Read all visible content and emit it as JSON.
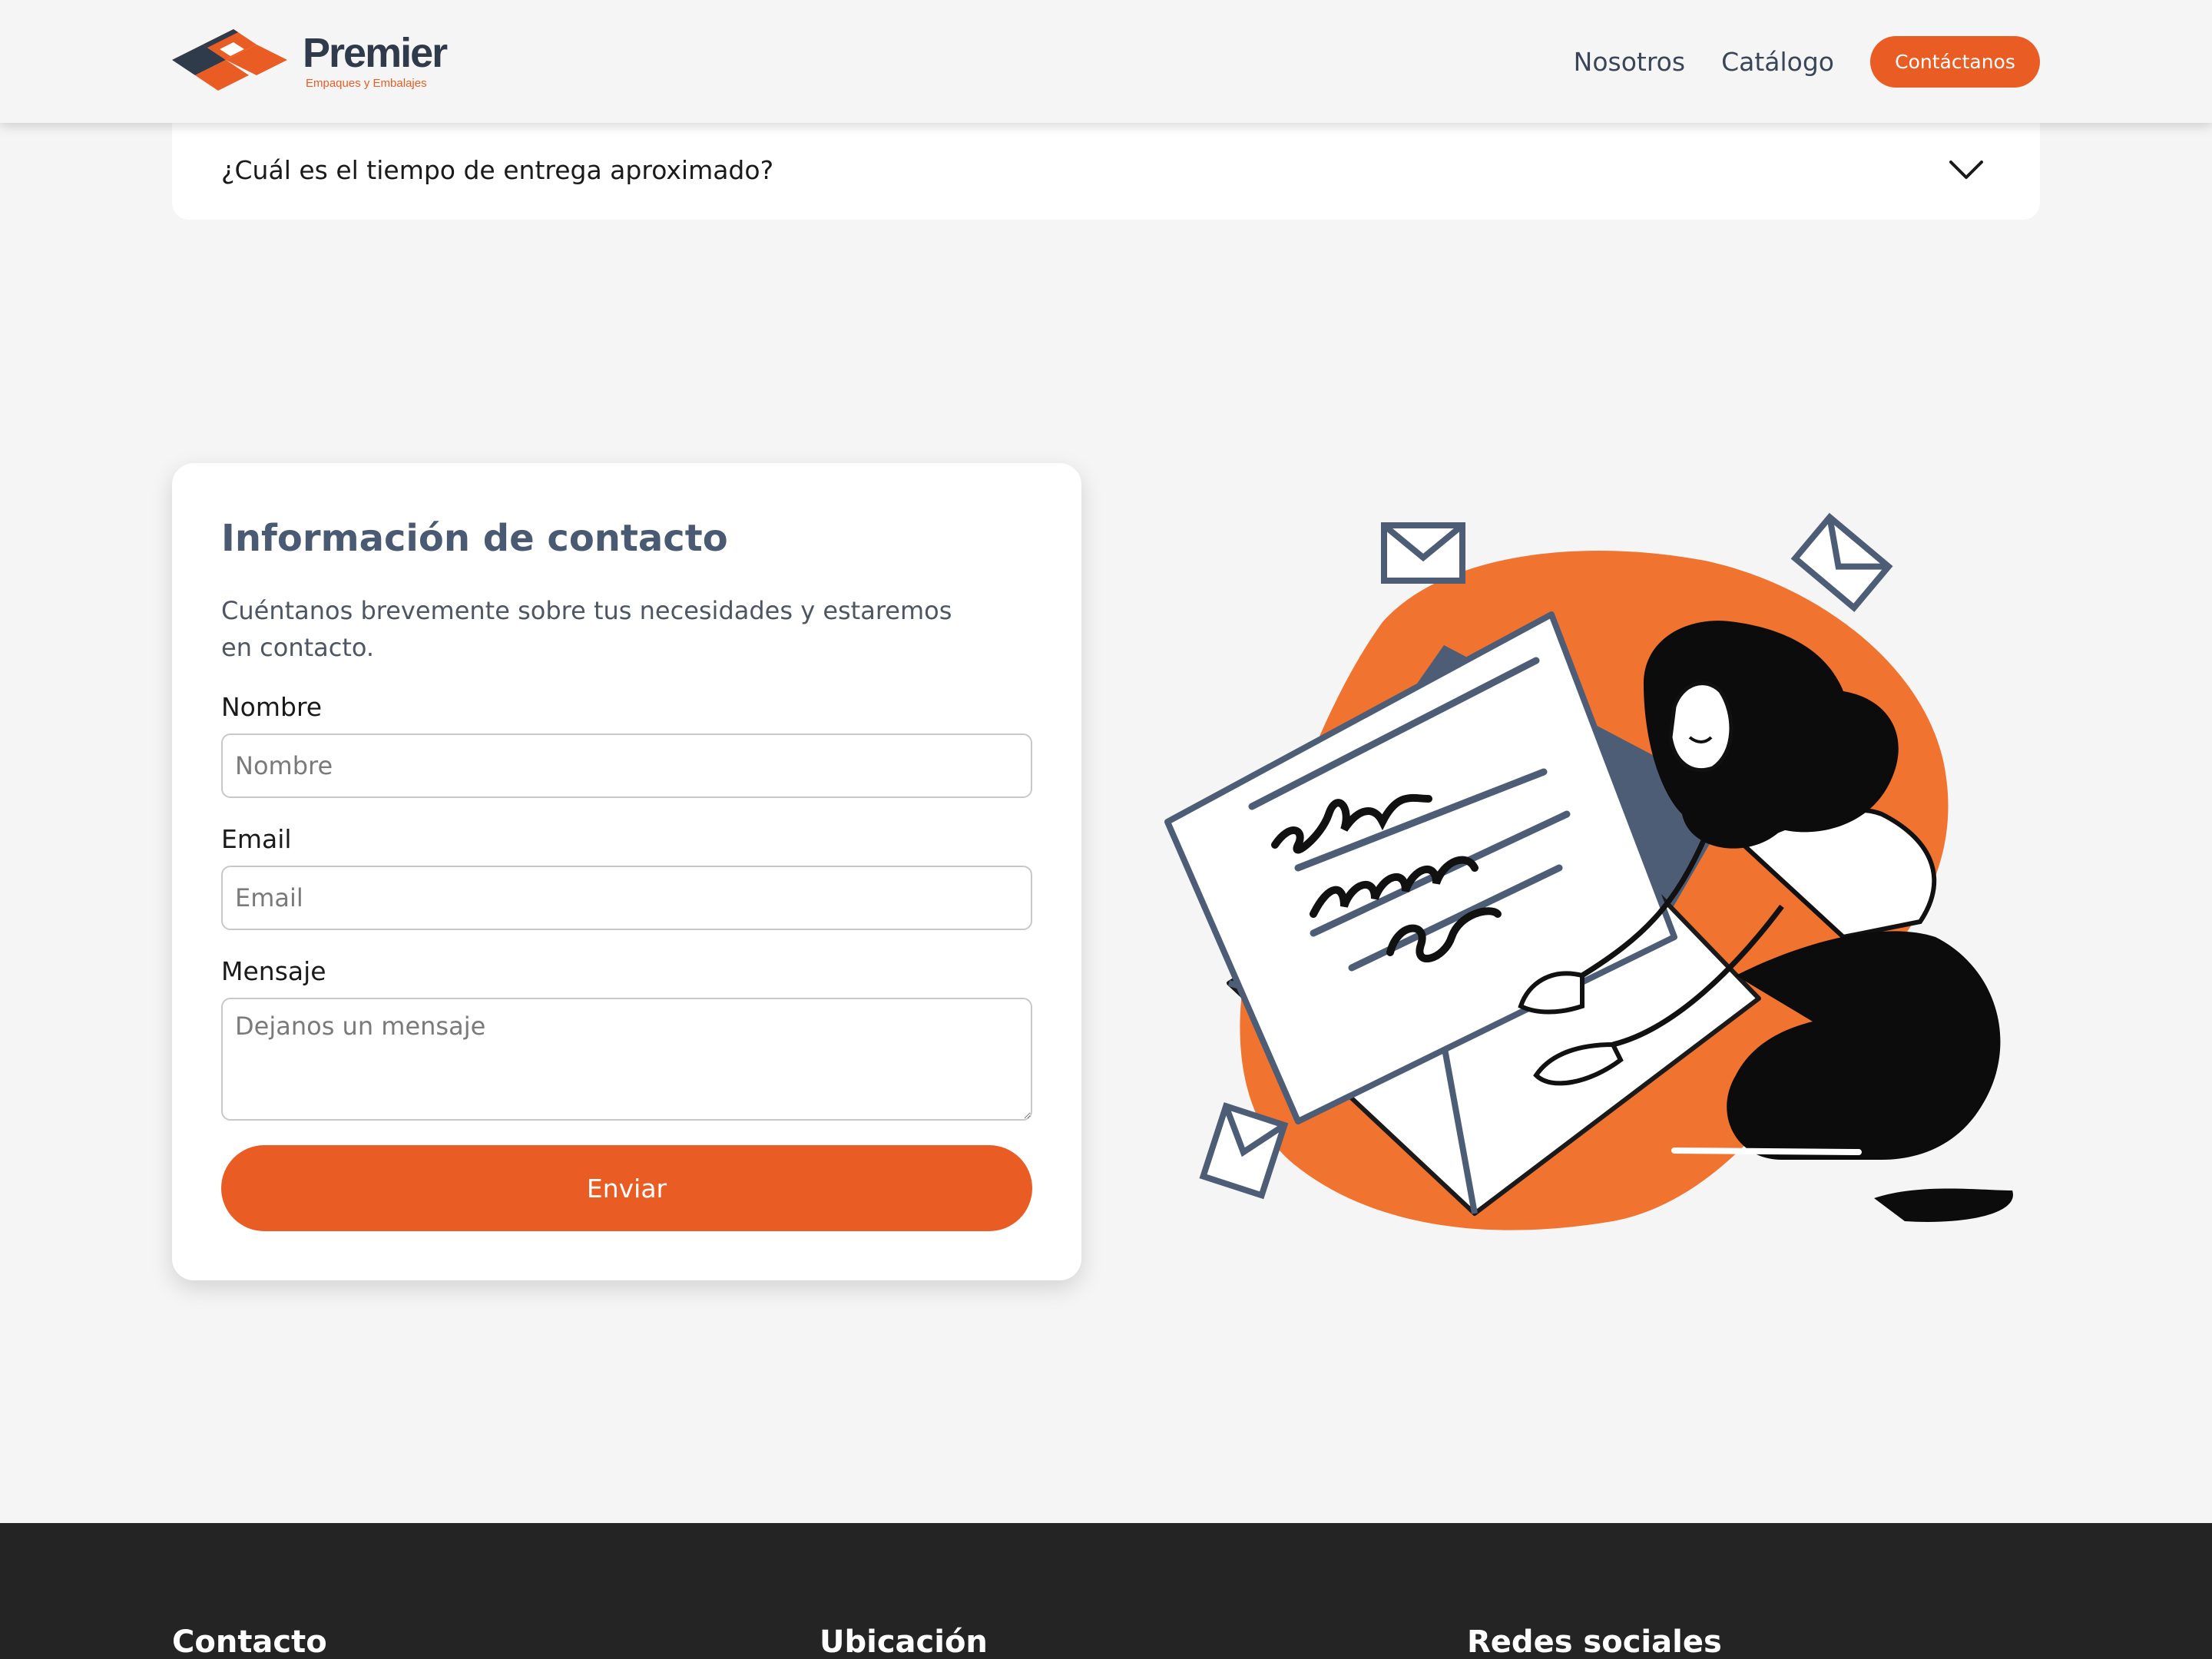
{
  "header": {
    "brand_name": "Premier",
    "brand_tagline": "Empaques y Embalajes",
    "nav": {
      "nosotros": "Nosotros",
      "catalogo": "Catálogo",
      "cta": "Contáctanos"
    }
  },
  "faq": {
    "question": "¿Cuál es el tiempo de entrega aproximado?"
  },
  "contact": {
    "title": "Información de contacto",
    "description": "Cuéntanos brevemente sobre tus necesidades y estaremos en contacto.",
    "fields": {
      "name": {
        "label": "Nombre",
        "placeholder": "Nombre",
        "value": ""
      },
      "email": {
        "label": "Email",
        "placeholder": "Email",
        "value": ""
      },
      "message": {
        "label": "Mensaje",
        "placeholder": "Dejanos un mensaje",
        "value": ""
      }
    },
    "submit": "Enviar"
  },
  "footer": {
    "contacto": "Contacto",
    "ubicacion": "Ubicación",
    "redes": "Redes sociales"
  },
  "colors": {
    "accent": "#e95c23",
    "slate": "#4a5a72",
    "footer_bg": "#242424"
  },
  "icons": {
    "faq_toggle": "chevron-down-icon",
    "logo_mark": "premier-logo-mark"
  }
}
